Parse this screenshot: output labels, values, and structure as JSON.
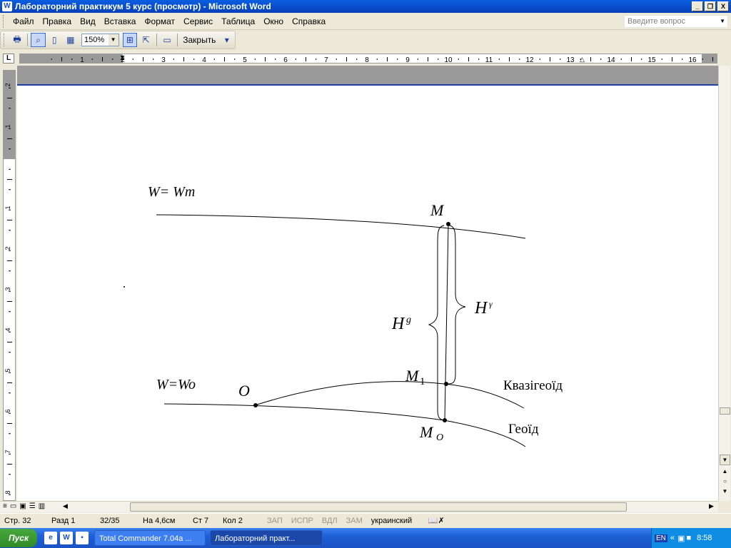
{
  "window": {
    "title": "Лабораторний практикум 5 курс (просмотр) - Microsoft Word",
    "app_icon": "W",
    "buttons": [
      "_",
      "❐",
      "X"
    ]
  },
  "menu": {
    "items": [
      {
        "label": "Файл"
      },
      {
        "label": "Правка"
      },
      {
        "label": "Вид"
      },
      {
        "label": "Вставка"
      },
      {
        "label": "Формат"
      },
      {
        "label": "Сервис"
      },
      {
        "label": "Таблица"
      },
      {
        "label": "Окно"
      },
      {
        "label": "Справка"
      }
    ],
    "ask_placeholder": "Введите вопрос"
  },
  "toolbar": {
    "zoom_value": "150%",
    "close_label": "Закрыть"
  },
  "ruler": {
    "h_labels": [
      "1",
      "2",
      "3",
      "4",
      "5",
      "6",
      "7",
      "8",
      "9",
      "10",
      "11",
      "12",
      "13",
      "14",
      "15",
      "16"
    ],
    "v_labels": [
      "2",
      "1",
      "1",
      "2",
      "3",
      "4",
      "5",
      "6",
      "7",
      "8"
    ]
  },
  "figure": {
    "label_w_wm": "W= Wm",
    "label_w_wo": "W=Wo",
    "label_m": "M",
    "label_m1": "M",
    "label_m1_sub": "1",
    "label_mo": "M",
    "label_mo_sub": "O",
    "label_o": "O",
    "label_hg": "H",
    "label_hg_sup": "g",
    "label_hy": "H",
    "label_hy_sup": "γ",
    "label_quasigeoid": "Квазігеоїд",
    "label_geoid": "Геоїд"
  },
  "statusbar": {
    "page": "Стр. 32",
    "section": "Разд 1",
    "pages": "32/35",
    "at": "На 4,6см",
    "line": "Ст 7",
    "col": "Кол 2",
    "rec": "ЗАП",
    "trk": "ИСПР",
    "ext": "ВДЛ",
    "ovr": "ЗАМ",
    "language": "украинский"
  },
  "taskbar": {
    "start_label": "Пуск",
    "tasks": [
      {
        "label": "Total Commander 7.04a ..."
      },
      {
        "label": "Лабораторний практ..."
      }
    ],
    "lang_indicator": "EN",
    "clock": "8:58"
  }
}
